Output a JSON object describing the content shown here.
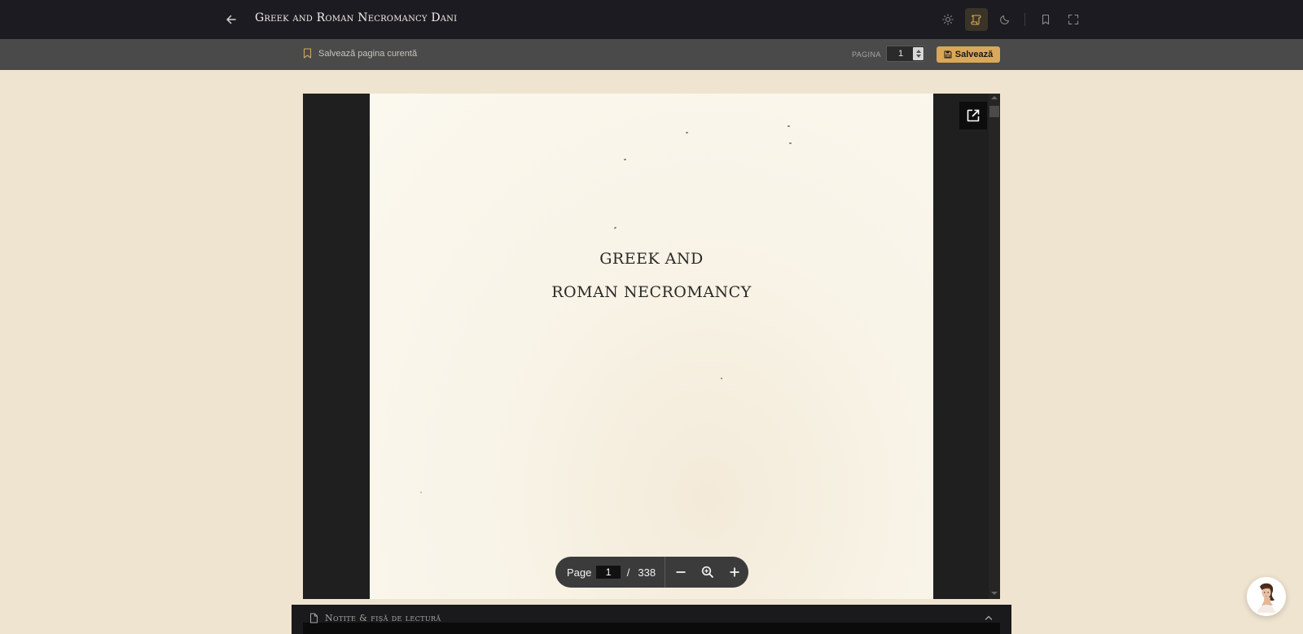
{
  "header": {
    "title": "Greek and Roman Necromancy Dani",
    "icons": [
      "arrow-left-icon",
      "sun-icon",
      "scroll-icon",
      "moon-icon",
      "bookmark-icon",
      "fullscreen-icon"
    ]
  },
  "toolbar": {
    "bookmark_label": "Salvează pagina curentă",
    "page_label": "PAGINA",
    "page_value": "1",
    "save_label": "Salvează"
  },
  "pdf": {
    "title_line1": "GREEK AND",
    "title_line2": "ROMAN NECROMANCY",
    "controls": {
      "page_label": "Page",
      "current_page": "1",
      "separator": "/",
      "total_pages": "338"
    }
  },
  "notes": {
    "label": "Notițe & fișă de lectură"
  },
  "colors": {
    "accent": "#d9a85a",
    "topbar": "#1c1b21",
    "subbar": "#4a4a4a",
    "background": "#efe4d0"
  }
}
